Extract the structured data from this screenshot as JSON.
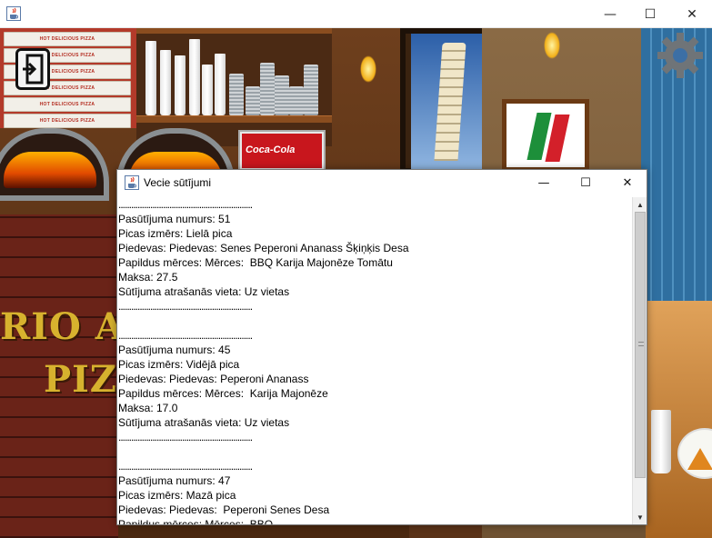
{
  "main_window": {
    "icon": "java-cup-icon",
    "controls": {
      "minimize": "—",
      "maximize": "☐",
      "close": "✕"
    }
  },
  "scene": {
    "pizza_box_label": "HOT DELICIOUS PIZZA",
    "cooler_label": "Coca-Cola",
    "logo_lines": [
      "RIO AND",
      "PIZZ"
    ],
    "exit_icon": "exit-door-icon",
    "settings_icon": "gear-icon"
  },
  "dialog": {
    "title": "Vecie sūtījumi",
    "icon": "java-cup-icon",
    "controls": {
      "minimize": "—",
      "maximize": "☐",
      "close": "✕"
    },
    "lines": [
      "...............................................................",
      "Pasūtījuma numurs: 51",
      "Picas izmērs: Lielā pica",
      "Piedevas: Piedevas: Senes Peperoni Ananass Šķiņķis Desa",
      "Papildus mērces: Mērces:  BBQ Karija Majonēze Tomātu",
      "Maksa: 27.5",
      "Sūtījuma atrašanās vieta: Uz vietas",
      "...............................................................",
      "",
      "...............................................................",
      "Pasūtījuma numurs: 45",
      "Picas izmērs: Vidējā pica",
      "Piedevas: Piedevas: Peperoni Ananass",
      "Papildus mērces: Mērces:  Karija Majonēze",
      "Maksa: 17.0",
      "Sūtījuma atrašanās vieta: Uz vietas",
      "...............................................................",
      "",
      "...............................................................",
      "Pasūtījuma numurs: 47",
      "Picas izmērs: Mazā pica",
      "Piedevas: Piedevas:  Peperoni Senes Desa",
      "Papildus mērces: Mērces:  BBQ"
    ],
    "scrollbar": {
      "up_arrow": "▲",
      "down_arrow": "▼"
    }
  }
}
